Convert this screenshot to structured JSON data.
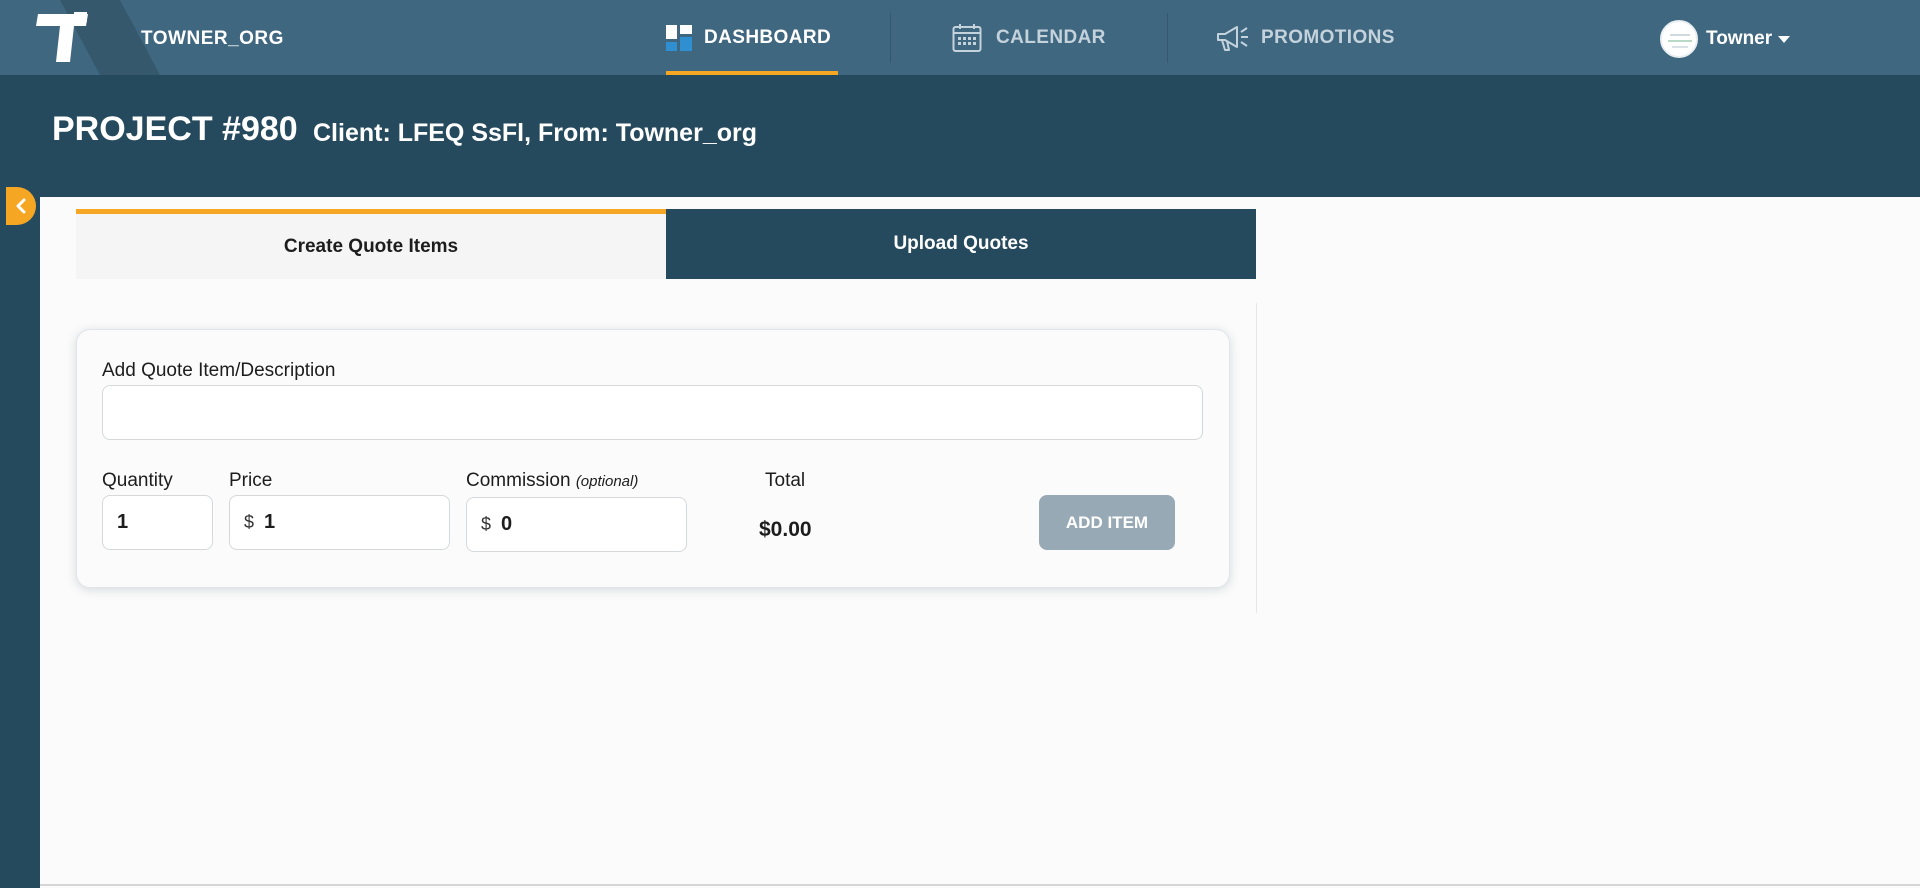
{
  "topbar": {
    "org_name": "TOWNER_ORG",
    "logo_icon": "towner-t-logo",
    "nav": [
      {
        "label": "DASHBOARD",
        "icon": "dashboard-icon",
        "active": true
      },
      {
        "label": "CALENDAR",
        "icon": "calendar-icon",
        "active": false
      },
      {
        "label": "PROMOTIONS",
        "icon": "megaphone-icon",
        "active": false
      }
    ],
    "user": {
      "name": "Towner",
      "icon": "chevron-down-icon"
    }
  },
  "header": {
    "title": "PROJECT #980",
    "meta": "Client: LFEQ SsFl, From: Towner_org"
  },
  "tabs": [
    {
      "label": "Create Quote Items",
      "active": true
    },
    {
      "label": "Upload Quotes",
      "active": false
    }
  ],
  "form": {
    "description_label": "Add Quote Item/Description",
    "description_value": "",
    "quantity_label": "Quantity",
    "quantity_value": "1",
    "price_label": "Price",
    "price_currency": "$",
    "price_value": "1",
    "commission_label": "Commission",
    "commission_optional": "(optional)",
    "commission_currency": "$",
    "commission_value": "0",
    "total_label": "Total",
    "total_value": "$0.00",
    "add_button": "ADD ITEM"
  },
  "colors": {
    "topbar": "#3f6780",
    "header": "#264a5d",
    "accent": "#f5a623",
    "add_button_disabled": "#97a9b4"
  }
}
